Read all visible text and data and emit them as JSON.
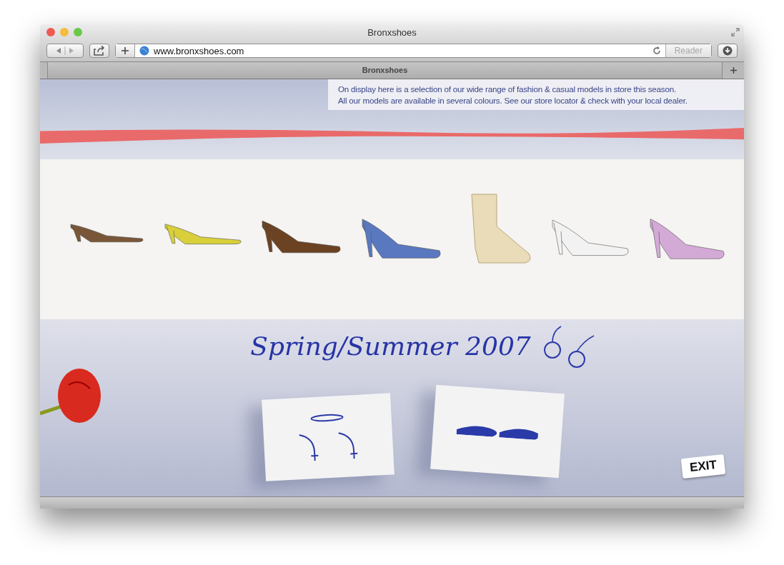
{
  "window": {
    "title": "Bronxshoes"
  },
  "toolbar": {
    "url": "www.bronxshoes.com",
    "reader_label": "Reader"
  },
  "tabs": [
    {
      "label": "Bronxshoes",
      "selected": true
    }
  ],
  "page": {
    "intro": [
      "On display here is a selection of our wide range of fashion & casual models in store this season.",
      "All our models are available in several colours. See our store locator & check with your local dealer."
    ],
    "headline": "Spring/Summer 2007",
    "exit_label": "EXIT"
  }
}
